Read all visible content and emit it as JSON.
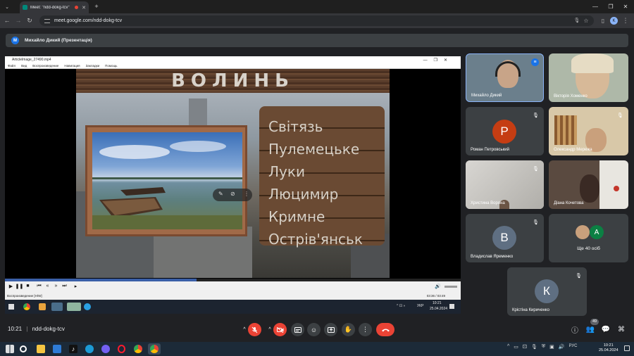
{
  "browser": {
    "tab_title": "Meet: \"ndd-dokg-tcv\"",
    "url": "meet.google.com/ndd-dokg-tcv"
  },
  "presenter": {
    "avatar_letter": "M",
    "label": "Михайло Дикий (Презентація)"
  },
  "player": {
    "window_title": "ArticleImage_27490.mp4",
    "menu": [
      "Файл",
      "Вид",
      "Воспроизведение",
      "Навигация",
      "Закладки",
      "Помощь"
    ],
    "status_text": "Воспроизведение [H/W]",
    "time_text": "03:36 / 03:49",
    "progress": 0.42
  },
  "slide": {
    "title": "ВОЛИНЬ",
    "places": [
      "Світязь",
      "Пулемецьке",
      "Луки",
      "Люцимир",
      "Кримне",
      "Острів'янськ"
    ]
  },
  "inner_taskbar": {
    "lang": "УКР",
    "time": "10:21",
    "date": "25.04.2024"
  },
  "participants": [
    {
      "name": "Михайло Дикий",
      "type": "video"
    },
    {
      "name": "Вікторія Хоменко",
      "type": "video"
    },
    {
      "name": "Роман Петровський",
      "type": "avatar",
      "letter": "Р",
      "color": "#c53d13"
    },
    {
      "name": "Олександр Мережа",
      "type": "video"
    },
    {
      "name": "Христина Ворона",
      "type": "video"
    },
    {
      "name": "Діана Кочетова",
      "type": "video"
    },
    {
      "name": "Владислав Яременко",
      "type": "avatar",
      "letter": "В",
      "color": "#5f6f82"
    },
    {
      "name": "Ще 40 осіб",
      "type": "more",
      "letter": "А",
      "color": "#0b8043"
    },
    {
      "name": "Крістіна Кириченко",
      "type": "avatar",
      "letter": "К",
      "color": "#5f6f82"
    }
  ],
  "bottom_bar": {
    "time": "10:21",
    "meeting_code": "ndd-dokg-tcv",
    "people_badge": "49"
  },
  "win_taskbar": {
    "lang": "РУС",
    "time": "10:21",
    "date": "25.04.2024"
  },
  "colors": {
    "meet_bg": "#202124",
    "tile_bg": "#3c4043",
    "red": "#ea4335",
    "accent": "#1a73e8"
  }
}
